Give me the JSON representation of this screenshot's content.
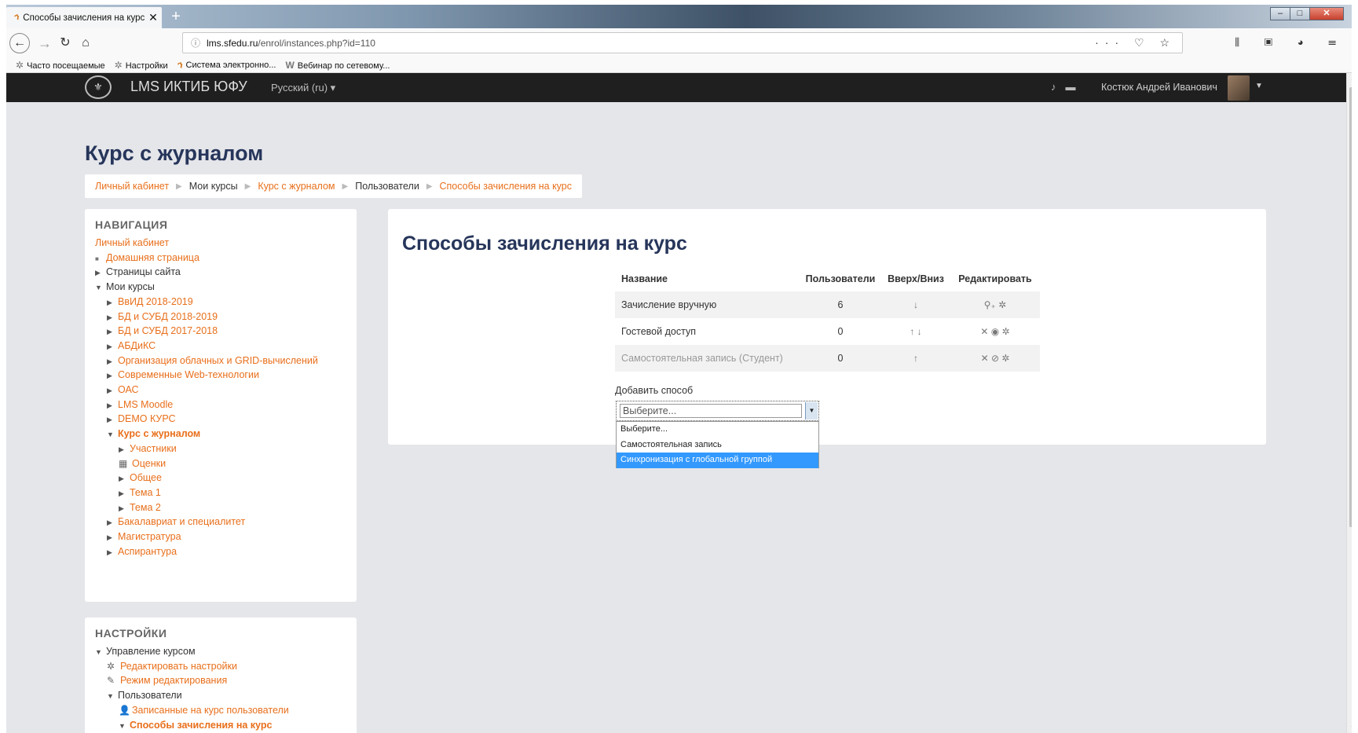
{
  "browser": {
    "tab_title": "Способы зачисления на курс",
    "tab_favicon": "moodle-icon",
    "url_host": "lms.sfedu.ru",
    "url_path": "/enrol/instances.php?id=110",
    "url_actions": "··· ♡ ☆",
    "bookmarks": [
      {
        "label": "Часто посещаемые",
        "icon": "gear-icon"
      },
      {
        "label": "Настройки",
        "icon": "gear-icon"
      },
      {
        "label": "Система электронно...",
        "icon": "moodle-icon"
      },
      {
        "label": "Вебинар по сетевому...",
        "icon": "wikipedia-icon"
      }
    ]
  },
  "header": {
    "brand": "LMS ИКТИБ ЮФУ",
    "language": "Русский (ru) ▾",
    "user_name": "Костюк Андрей Иванович"
  },
  "page": {
    "title": "Курс с журналом",
    "breadcrumb": [
      "Личный кабинет",
      "Мои курсы",
      "Курс с журналом",
      "Пользователи",
      "Способы зачисления на курс"
    ]
  },
  "nav": {
    "title": "НАВИГАЦИЯ",
    "items": [
      {
        "label": "Личный кабинет",
        "level": 0,
        "marker": "none",
        "style": "link"
      },
      {
        "label": "Домашняя страница",
        "level": 0,
        "marker": "dot",
        "style": "link"
      },
      {
        "label": "Страницы сайта",
        "level": 0,
        "marker": "collapsed",
        "style": "text"
      },
      {
        "label": "Мои курсы",
        "level": 0,
        "marker": "expanded",
        "style": "text"
      },
      {
        "label": "ВвИД 2018-2019",
        "level": 1,
        "marker": "collapsed",
        "style": "link"
      },
      {
        "label": "БД и СУБД 2018-2019",
        "level": 1,
        "marker": "collapsed",
        "style": "link"
      },
      {
        "label": "БД и СУБД 2017-2018",
        "level": 1,
        "marker": "collapsed",
        "style": "link"
      },
      {
        "label": "АБДиКС",
        "level": 1,
        "marker": "collapsed",
        "style": "link"
      },
      {
        "label": "Организация облачных и GRID-вычислений",
        "level": 1,
        "marker": "collapsed",
        "style": "link"
      },
      {
        "label": "Современные Web-технологии",
        "level": 1,
        "marker": "collapsed",
        "style": "link"
      },
      {
        "label": "ОАС",
        "level": 1,
        "marker": "collapsed",
        "style": "link"
      },
      {
        "label": "LMS Moodle",
        "level": 1,
        "marker": "collapsed",
        "style": "link"
      },
      {
        "label": "DEMO КУРС",
        "level": 1,
        "marker": "collapsed",
        "style": "link"
      },
      {
        "label": "Курс с журналом",
        "level": 1,
        "marker": "expanded",
        "style": "bold"
      },
      {
        "label": "Участники",
        "level": 2,
        "marker": "collapsed",
        "style": "link"
      },
      {
        "label": "Оценки",
        "level": 2,
        "marker": "grades-icon",
        "style": "link"
      },
      {
        "label": "Общее",
        "level": 2,
        "marker": "collapsed",
        "style": "link"
      },
      {
        "label": "Тема 1",
        "level": 2,
        "marker": "collapsed",
        "style": "link"
      },
      {
        "label": "Тема 2",
        "level": 2,
        "marker": "collapsed",
        "style": "link"
      },
      {
        "label": "Бакалавриат и специалитет",
        "level": 1,
        "marker": "collapsed",
        "style": "link"
      },
      {
        "label": "Магистратура",
        "level": 1,
        "marker": "collapsed",
        "style": "link"
      },
      {
        "label": "Аспирантура",
        "level": 1,
        "marker": "collapsed",
        "style": "link"
      }
    ]
  },
  "settings": {
    "title": "НАСТРОЙКИ",
    "items": [
      {
        "label": "Управление курсом",
        "level": 0,
        "marker": "expanded",
        "style": "text"
      },
      {
        "label": "Редактировать настройки",
        "level": 1,
        "marker": "gear-icon",
        "style": "link"
      },
      {
        "label": "Режим редактирования",
        "level": 1,
        "marker": "pencil-icon",
        "style": "link"
      },
      {
        "label": "Пользователи",
        "level": 1,
        "marker": "expanded",
        "style": "text"
      },
      {
        "label": "Записанные на курс пользователи",
        "level": 2,
        "marker": "user-icon",
        "style": "link"
      },
      {
        "label": "Способы зачисления на курс",
        "level": 2,
        "marker": "expanded",
        "style": "bold"
      }
    ]
  },
  "main": {
    "title": "Способы зачисления на курс",
    "columns": [
      "Название",
      "Пользователи",
      "Вверх/Вниз",
      "Редактировать"
    ],
    "rows": [
      {
        "name": "Зачисление вручную",
        "users": "6",
        "updown": "↓",
        "edit": "⚲₊ ✲",
        "disabled": false
      },
      {
        "name": "Гостевой доступ",
        "users": "0",
        "updown": "↑ ↓",
        "edit": "✕ ◉ ✲",
        "disabled": false
      },
      {
        "name": "Самостоятельная запись (Студент)",
        "users": "0",
        "updown": "↑",
        "edit": "✕ ⊘ ✲",
        "disabled": true
      }
    ],
    "add_label": "Добавить способ",
    "select_value": "Выберите...",
    "options": [
      "Выберите...",
      "Самостоятельная запись",
      "Синхронизация с глобальной группой"
    ],
    "selected_option_index": 2
  }
}
